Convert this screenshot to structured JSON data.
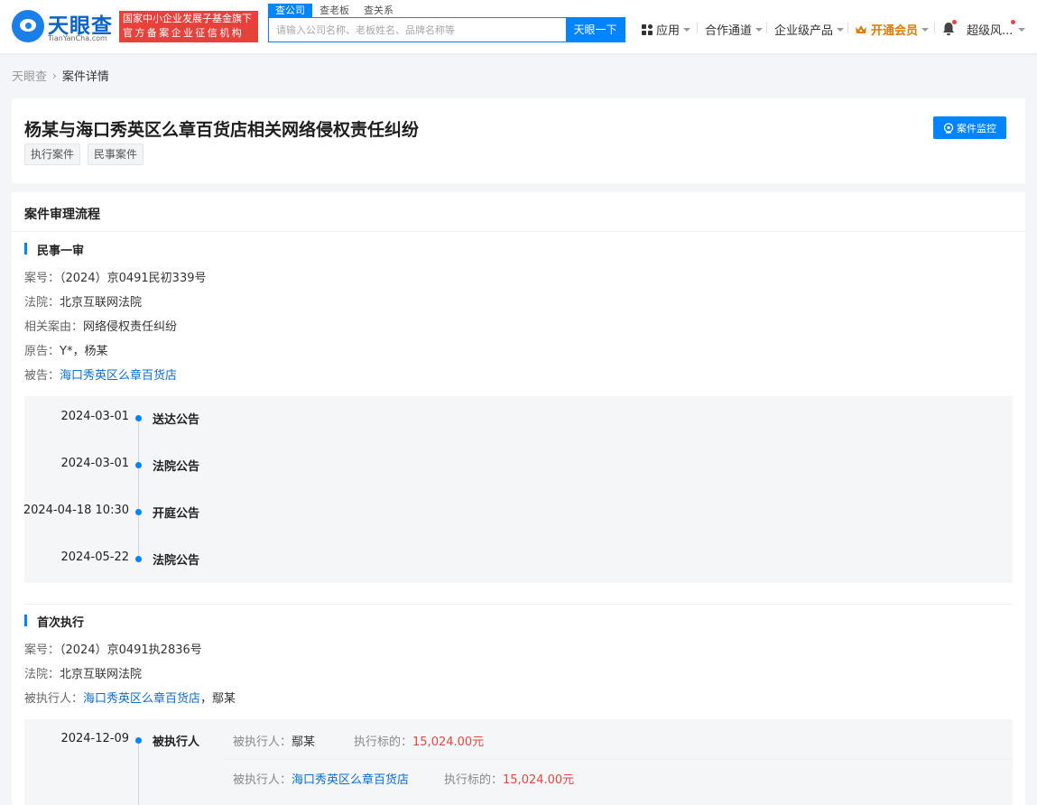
{
  "header": {
    "logo_title": "天眼查",
    "logo_sub": "TianYanCha.com",
    "banner_line1": "国家中小企业发展子基金旗下",
    "banner_line2": "官方备案企业征信机构",
    "search_tabs": [
      "查公司",
      "查老板",
      "查关系"
    ],
    "search_placeholder": "请输入公司名称、老板姓名、品牌名称等",
    "search_button": "天眼一下",
    "nav": {
      "apps": "应用",
      "partner": "合作通道",
      "enterprise": "企业级产品",
      "vip": "开通会员",
      "user": "超级风..."
    },
    "colors": {
      "brand": "#0084ff",
      "banner": "#e8413c",
      "vip": "#e07b00"
    }
  },
  "breadcrumb": {
    "home": "天眼查",
    "current": "案件详情"
  },
  "case": {
    "title": "杨某与海口秀英区么章百货店相关网络侵权责任纠纷",
    "tags": [
      "执行案件",
      "民事案件"
    ],
    "monitor_button": "案件监控"
  },
  "process": {
    "heading": "案件审理流程",
    "stage1": {
      "title": "民事一审",
      "case_no_label": "案号：",
      "case_no": "（2024）京0491民初339号",
      "court_label": "法院：",
      "court": "北京互联网法院",
      "cause_label": "相关案由：",
      "cause": "网络侵权责任纠纷",
      "plaintiff_label": "原告：",
      "plaintiff": "Y*，杨某",
      "defendant_label": "被告：",
      "defendant": "海口秀英区么章百货店",
      "events": [
        {
          "date": "2024-03-01",
          "label": "送达公告"
        },
        {
          "date": "2024-03-01",
          "label": "法院公告"
        },
        {
          "date": "2024-04-18 10:30",
          "label": "开庭公告"
        },
        {
          "date": "2024-05-22",
          "label": "法院公告"
        }
      ]
    },
    "stage2": {
      "title": "首次执行",
      "case_no_label": "案号：",
      "case_no": "（2024）京0491执2836号",
      "court_label": "法院：",
      "court": "北京互联网法院",
      "executed_label": "被执行人：",
      "executed_link": "海口秀英区么章百货店",
      "executed_rest": "，鄢某",
      "event": {
        "date": "2024-12-09",
        "label": "被执行人"
      },
      "details": [
        {
          "person_label": "被执行人：",
          "person": "鄢某",
          "amount_label": "执行标的：",
          "amount": "15,024.00元"
        },
        {
          "person_label": "被执行人：",
          "person": "海口秀英区么章百货店",
          "amount_label": "执行标的：",
          "amount": "15,024.00元"
        }
      ]
    }
  }
}
